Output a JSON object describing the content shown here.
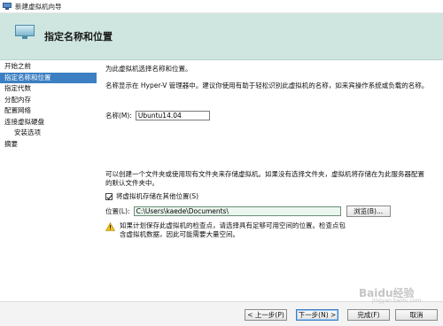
{
  "window": {
    "title": "新建虚拟机向导",
    "icon": "computer-icon"
  },
  "header": {
    "title": "指定名称和位置",
    "icon": "monitor-icon"
  },
  "sidebar": {
    "items": [
      {
        "label": "开始之前"
      },
      {
        "label": "指定名称和位置",
        "active": true
      },
      {
        "label": "指定代数"
      },
      {
        "label": "分配内存"
      },
      {
        "label": "配置网络"
      },
      {
        "label": "连接虚拟硬盘"
      },
      {
        "label": "安装选项",
        "indent": true
      },
      {
        "label": "摘要"
      }
    ]
  },
  "main": {
    "intro": "为此虚拟机选择名称和位置。",
    "name_desc": "名称显示在 Hyper-V 管理器中。建议你使用有助于轻松识别此虚拟机的名称，如来宾操作系统或负载的名称。",
    "name_label": "名称(M):",
    "name_value": "Ubuntu14.04",
    "folder_desc_1": "可以创建一个文件夹或使用现有文件夹来存储虚拟机。如果没有选择文件夹，虚拟机将存储在为此服务器配置",
    "folder_desc_2": "的默认文件夹中。",
    "store_checkbox_label": "将虚拟机存储在其他位置(S)",
    "store_checked": true,
    "location_label": "位置(L):",
    "location_value": "C:\\Users\\kaede\\Documents\\",
    "browse_label": "浏览(B)...",
    "warning_icon": "warning-icon",
    "warning_text": "如果计划保存此虚拟机的检查点，请选择具有足够可用空间的位置。检查点包含虚拟机数据，因此可能需要大量空间。"
  },
  "footer": {
    "prev": "< 上一步(P)",
    "next": "下一步(N) >",
    "finish": "完成(F)",
    "cancel": "取消"
  },
  "watermark": {
    "text": "Baidu经验",
    "sub": "jingyan.baidu.com"
  },
  "colors": {
    "header_bg": "#cfe6e0",
    "selection": "#3c7fc2",
    "location_bg": "#eaf6ee"
  }
}
